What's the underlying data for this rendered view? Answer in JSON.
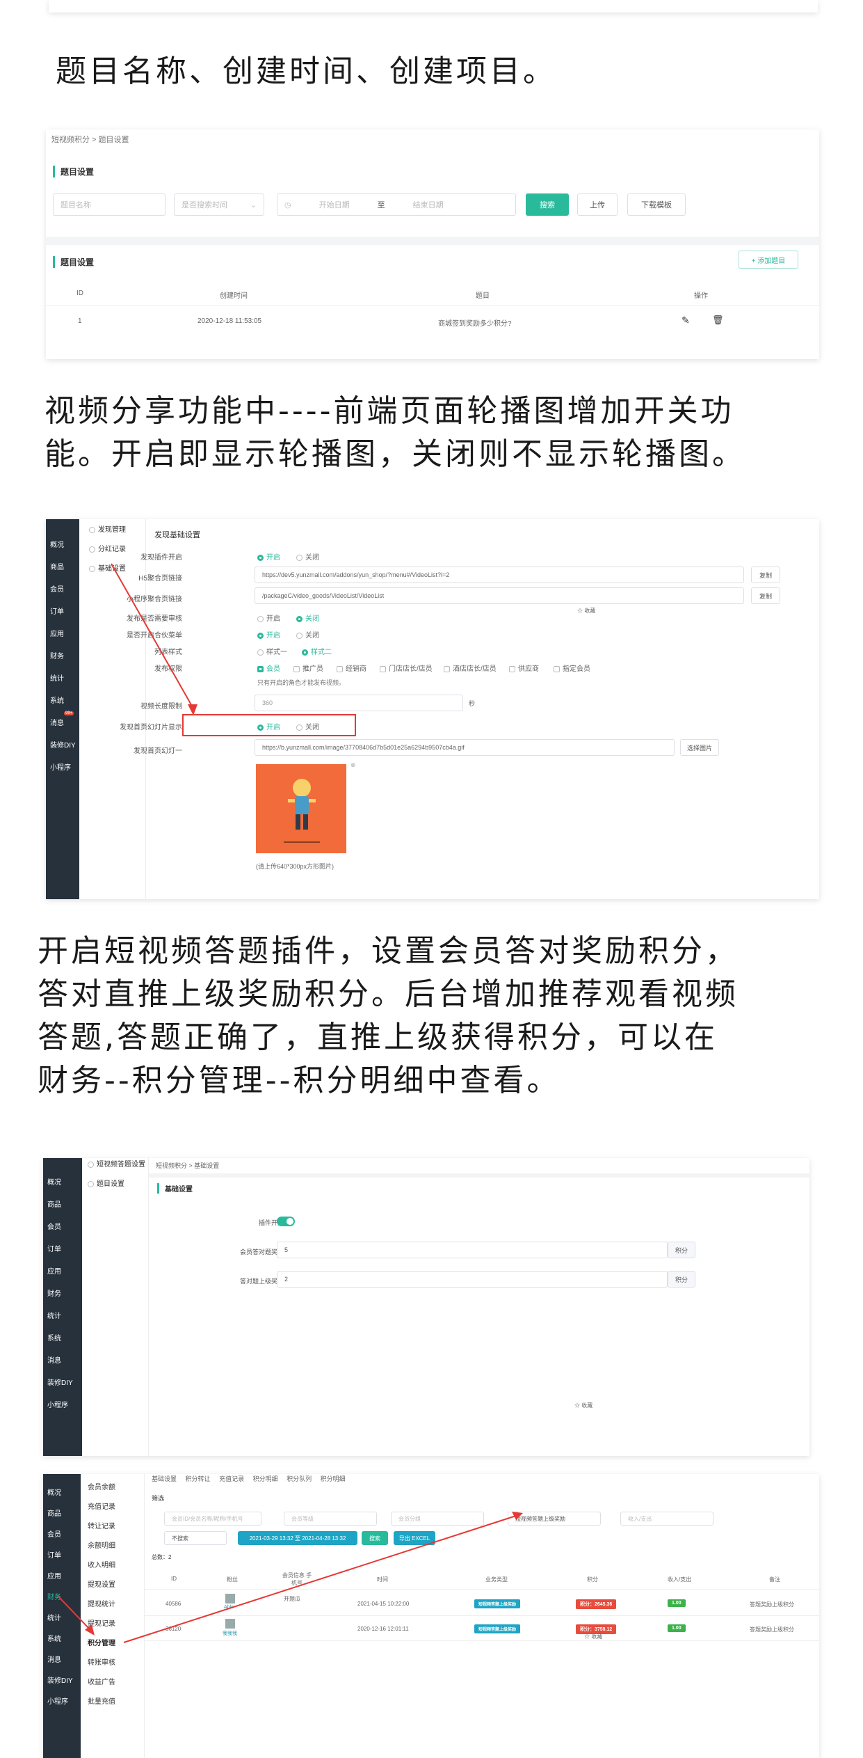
{
  "top_text": "题目名称、创建时间、创建项目。",
  "s1": {
    "breadcrumb": "短视频积分 > 题目设置",
    "section_title": "题目设置",
    "name_placeholder": "题目名称",
    "search_type": "是否搜索时间",
    "start_date": "开始日期",
    "range_sep": "至",
    "end_date": "结束日期",
    "search_btn": "搜索",
    "upload_btn": "上传",
    "template_btn": "下载模板",
    "list_title": "题目设置",
    "add_btn": "+ 添加题目",
    "headers": [
      "ID",
      "创建时间",
      "题目",
      "操作"
    ],
    "row": {
      "id": "1",
      "time": "2020-12-18 11:53:05",
      "question": "商城签到奖励多少积分?"
    }
  },
  "text2": [
    "视频分享功能中----前端页面轮播图增加开关功",
    "能。开启即显示轮播图，关闭则不显示轮播图。"
  ],
  "s2": {
    "sidebar": [
      "概况",
      "商品",
      "会员",
      "订单",
      "应用",
      "财务",
      "统计",
      "系统",
      "消息",
      "装修DIY",
      "小程序"
    ],
    "msg_badge": "99+",
    "submenu": [
      "发现管理",
      "分红记录",
      "基础设置"
    ],
    "panel_title": "发现基础设置",
    "rows": [
      {
        "label": "发现插件开启",
        "opts": [
          "开启",
          "关闭"
        ],
        "on": 0
      },
      {
        "label": "H5聚合页链接",
        "value": "https://dev5.yunzmall.com/addons/yun_shop/?menu#/VideoList?i=2",
        "btn": "复制"
      },
      {
        "label": "小程序聚合页链接",
        "value": "/packageC/video_goods/VideoList/VideoList",
        "btn": "复制"
      },
      {
        "label": "发布是否需要审核",
        "opts": [
          "开启",
          "关闭"
        ],
        "on": 1
      },
      {
        "label": "是否开启合伙菜单",
        "opts": [
          "开启",
          "关闭"
        ],
        "on": 0
      },
      {
        "label": "列表样式",
        "opts": [
          "样式一",
          "样式二"
        ],
        "on": 1
      },
      {
        "label": "发布权限",
        "opts": [
          "会员",
          "推广员",
          "经销商",
          "门店店长/店员",
          "酒店店长/店员",
          "供应商",
          "指定会员"
        ]
      },
      {
        "label": "视频长度限制",
        "value": "360",
        "unit": "秒"
      },
      {
        "label": "发现首页幻灯片显示",
        "opts": [
          "开启",
          "关闭"
        ],
        "on": 0
      },
      {
        "label": "发现首页幻灯一",
        "value": "https://b.yunzmall.com/image/37708406d7b5d01e25a6294b9507cb4a.gif",
        "btn": "选择图片"
      }
    ],
    "perm_note": "只有开启的角色才能发布视频。",
    "collect": "☆ 收藏",
    "upload_hint": "(请上传640*300px方形图片)"
  },
  "text3": [
    "开启短视频答题插件，设置会员答对奖励积分，",
    "答对直推上级奖励积分。后台增加推荐观看视频",
    "答题,答题正确了，直推上级获得积分，可以在",
    "财务--积分管理--积分明细中查看。"
  ],
  "s3": {
    "submenu": [
      "短视频答题设置",
      "题目设置"
    ],
    "breadcrumb": "短视频积分 > 基础设置",
    "section": "基础设置",
    "switch_label": "插件开关",
    "member_label": "会员答对题奖励",
    "member_value": "5",
    "parent_label": "答对题上级奖励",
    "parent_value": "2",
    "unit": "积分",
    "collect": "☆ 收藏"
  },
  "s4": {
    "tabs": [
      "基础设置",
      "积分转让",
      "充值记录",
      "积分明细",
      "积分队列",
      "积分明细"
    ],
    "filter": "筛选",
    "placeholders": [
      "会员ID/会员名称/昵称/手机号",
      "会员等级",
      "会员分组",
      "短视频答题上级奖励",
      "收入/支出"
    ],
    "dropdown": "不搜索",
    "date_range": "2021-03-29 13:32 至 2021-04-28 13:32",
    "search_btn": "搜索",
    "export_btn": "导出 EXCEL",
    "total": "总数：2",
    "headers": [
      "ID",
      "粉丝",
      "会员信息 手机号",
      "时间",
      "业务类型",
      "积分",
      "收入/支出",
      "备注"
    ],
    "rows": [
      {
        "id": "40586",
        "fan": "Able",
        "member": "开题瓜",
        "time": "2021-04-15 10:22:00",
        "type": "短视频答题上级奖励",
        "points": "积分：2645.36",
        "io": "1.00",
        "note": "答题奖励上级积分"
      },
      {
        "id": "36120",
        "fan": "我我我",
        "member": "",
        "time": "2020-12-16 12:01:11",
        "type": "短视频答题上级奖励",
        "points": "积分：3758.12",
        "io": "1.00",
        "note": "答题奖励上级积分"
      }
    ],
    "submenu": [
      "会员余额",
      "充值记录",
      "转让记录",
      "余额明细",
      "收入明细",
      "提现设置",
      "提现统计",
      "提现记录",
      "积分管理",
      "转账审核",
      "收益广告",
      "批量充值"
    ],
    "collect": "☆ 收藏"
  }
}
